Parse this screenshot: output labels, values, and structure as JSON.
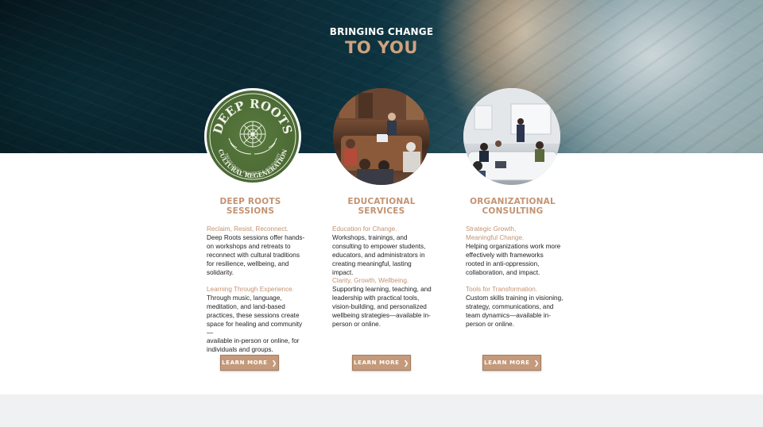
{
  "hero": {
    "eyebrow": "BRINGING CHANGE",
    "headline": "TO YOU"
  },
  "cards": [
    {
      "title_line1": "DEEP ROOTS",
      "title_line2": "SESSIONS",
      "logo": {
        "top_text": "DEEP ROOTS",
        "bottom_text": "CULTURAL REGENERATION",
        "small_text": "DECOLONIAL PRACTICE & SOLIDARITY"
      },
      "blocks": [
        {
          "lead": "Reclaim, Resist, Reconnect.",
          "lines": [
            "Deep Roots sessions offer hands-",
            "on workshops and retreats to",
            "reconnect with cultural traditions",
            "for resilience, wellbeing, and",
            "solidarity."
          ]
        },
        {
          "lead": "Learning Through Experience.",
          "lines": [
            "Through music, language,",
            "meditation, and land-based",
            "practices, these sessions create",
            "space for healing and community—",
            "available in-person or online, for",
            "individuals and groups."
          ]
        }
      ],
      "button": "LEARN MORE"
    },
    {
      "title_line1": "EDUCATIONAL",
      "title_line2": "SERVICES",
      "blocks": [
        {
          "lead": "Education for Change.",
          "lines": [
            "Workshops, trainings, and",
            "consulting to empower students,",
            "educators, and administrators in",
            "creating meaningful, lasting impact."
          ]
        },
        {
          "lead": "Clarity, Growth, Wellbeing.",
          "lines": [
            "Supporting learning, teaching, and",
            "leadership with practical tools,",
            "vision-building, and personalized",
            "wellbeing strategies—available in-",
            "person or online."
          ]
        }
      ],
      "button": "LEARN MORE"
    },
    {
      "title_line1": "ORGANIZATIONAL",
      "title_line2": "CONSULTING",
      "blocks": [
        {
          "lead": "Strategic Growth,",
          "lead2": "Meaningful Change.",
          "lines": [
            "Helping organizations work more",
            "effectively with frameworks",
            "rooted in anti-oppression,",
            "collaboration, and impact."
          ]
        },
        {
          "lead": "Tools for Transformation.",
          "lines": [
            "Custom skills training in visioning,",
            "strategy, communications, and",
            "team dynamics—available in-",
            "person or online."
          ]
        }
      ],
      "button": "LEARN MORE"
    }
  ],
  "colors": {
    "accent": "#c39372",
    "button_bg": "#c49a7a",
    "logo_green": "#4d6c36",
    "footer_band": "#f0f1f3"
  },
  "icons": {
    "button_chevron": "chevron-right-icon"
  }
}
